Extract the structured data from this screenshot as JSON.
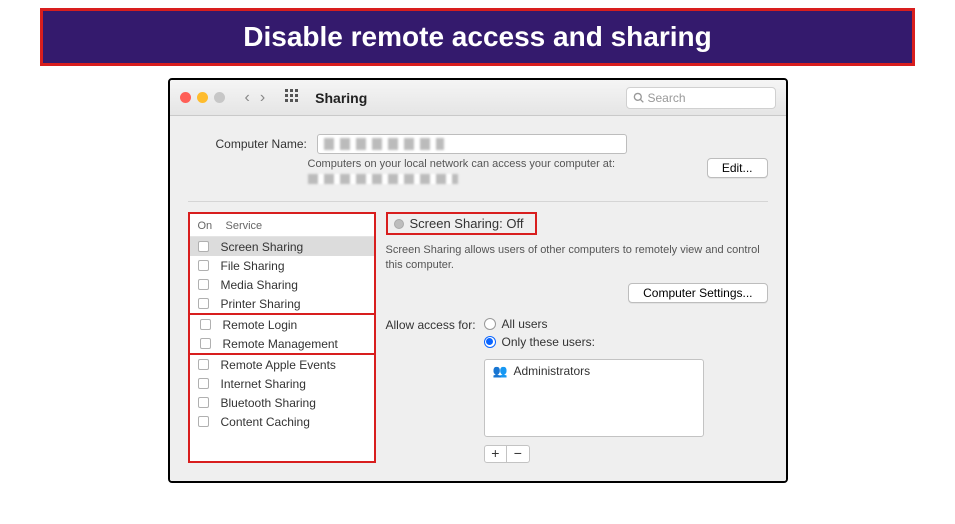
{
  "banner": {
    "title": "Disable remote access and sharing"
  },
  "toolbar": {
    "title": "Sharing",
    "search_placeholder": "Search"
  },
  "computer_name": {
    "label": "Computer Name:",
    "subtext": "Computers on your local network can access your computer at:",
    "edit_label": "Edit..."
  },
  "services": {
    "header_on": "On",
    "header_service": "Service",
    "items": [
      {
        "label": "Screen Sharing"
      },
      {
        "label": "File Sharing"
      },
      {
        "label": "Media Sharing"
      },
      {
        "label": "Printer Sharing"
      },
      {
        "label": "Remote Login"
      },
      {
        "label": "Remote Management"
      },
      {
        "label": "Remote Apple Events"
      },
      {
        "label": "Internet Sharing"
      },
      {
        "label": "Bluetooth Sharing"
      },
      {
        "label": "Content Caching"
      }
    ]
  },
  "detail": {
    "status_label": "Screen Sharing: Off",
    "description": "Screen Sharing allows users of other computers to remotely view and control this computer.",
    "computer_settings_label": "Computer Settings...",
    "access_label": "Allow access for:",
    "access_all": "All users",
    "access_only": "Only these users:",
    "users": [
      {
        "label": "Administrators"
      }
    ],
    "plus": "+",
    "minus": "−"
  }
}
